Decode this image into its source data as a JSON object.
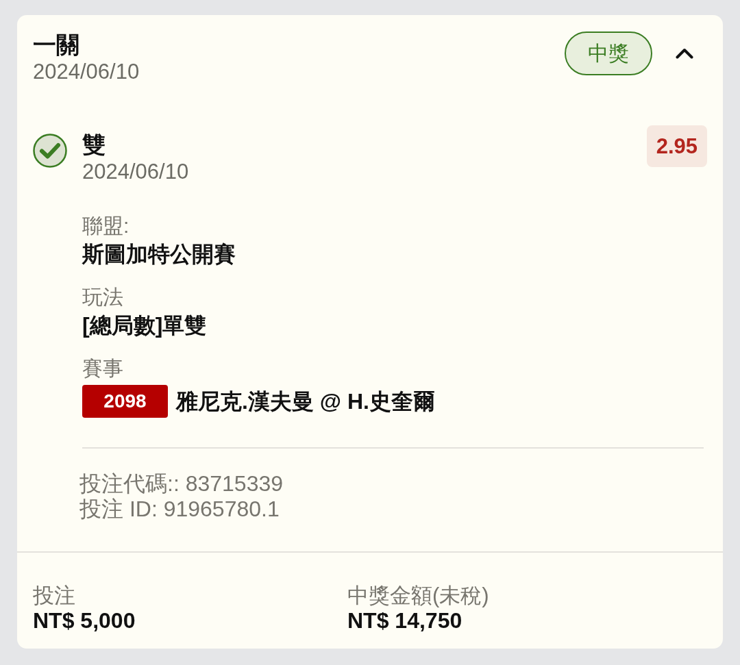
{
  "header": {
    "title": "一關",
    "date": "2024/06/10",
    "status": {
      "label": "中獎",
      "kind": "won"
    },
    "expanded": true
  },
  "selection": {
    "won": true,
    "title": "雙",
    "date": "2024/06/10",
    "odds": "2.95",
    "fields": [
      {
        "kind": "text",
        "label": "聯盟:",
        "value": "斯圖加特公開賽"
      },
      {
        "kind": "text",
        "label": "玩法",
        "value": "[總局數]單雙"
      },
      {
        "kind": "event",
        "label": "賽事",
        "event_number": "2098",
        "value": "雅尼克.漢夫曼 @ H.史奎爾"
      }
    ]
  },
  "bet_info": [
    "投注代碼:: 83715339",
    "投注 ID: 91965780.1"
  ],
  "footer": [
    {
      "label": "投注",
      "amount": "NT$ 5,000"
    },
    {
      "label": "中獎金額(未稅)",
      "amount": "NT$ 14,750"
    }
  ]
}
